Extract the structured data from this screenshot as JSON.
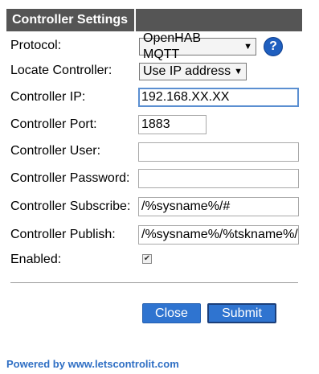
{
  "section": {
    "title": "Controller Settings"
  },
  "fields": {
    "protocol": {
      "label": "Protocol:",
      "value": "OpenHAB MQTT"
    },
    "locate": {
      "label": "Locate Controller:",
      "value": "Use IP address"
    },
    "ip": {
      "label": "Controller IP:",
      "value": "192.168.XX.XX"
    },
    "port": {
      "label": "Controller Port:",
      "value": "1883"
    },
    "user": {
      "label": "Controller User:",
      "value": ""
    },
    "password": {
      "label": "Controller Password:",
      "value": ""
    },
    "subscribe": {
      "label": "Controller Subscribe:",
      "value": "/%sysname%/#"
    },
    "publish": {
      "label": "Controller Publish:",
      "value": "/%sysname%/%tskname%/"
    },
    "enabled": {
      "label": "Enabled:",
      "checked": true
    }
  },
  "help_glyph": "?",
  "buttons": {
    "close": "Close",
    "submit": "Submit"
  },
  "footer": "Powered by www.letscontrolit.com",
  "colors": {
    "header_bg": "#555555",
    "button_bg": "#2f74d0",
    "link": "#2f6fc4",
    "help_icon": "#1f5fbf"
  }
}
